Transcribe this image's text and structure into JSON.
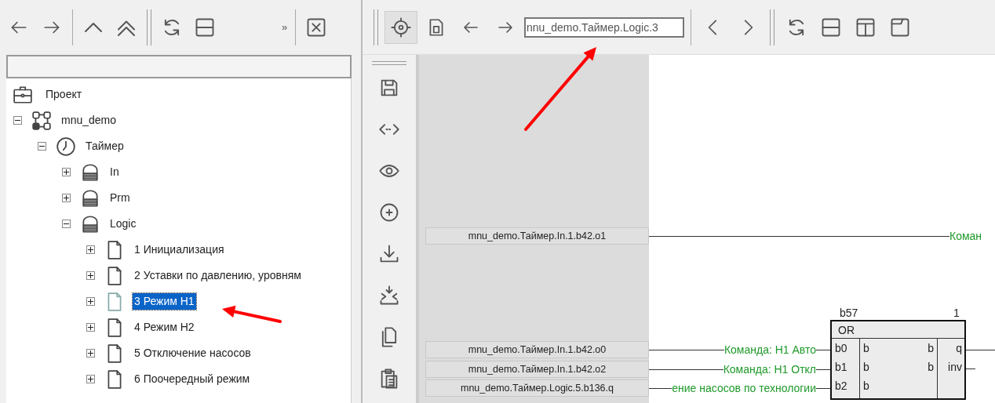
{
  "left_toolbar": {
    "overflow": "»"
  },
  "tree": [
    {
      "label": "Проект",
      "kind": "project",
      "selected": false,
      "children": [
        {
          "label": "mnu_demo",
          "kind": "network",
          "expanded": true,
          "selected": false,
          "children": [
            {
              "label": "Таймер",
              "kind": "clock",
              "expanded": true,
              "selected": false,
              "children": [
                {
                  "label": "In",
                  "kind": "stack",
                  "expanded": false,
                  "selected": false
                },
                {
                  "label": "Prm",
                  "kind": "stack",
                  "expanded": false,
                  "selected": false
                },
                {
                  "label": "Logic",
                  "kind": "stack",
                  "expanded": true,
                  "selected": false,
                  "children": [
                    {
                      "label": "1 Инициализация",
                      "kind": "page",
                      "expanded": false,
                      "selected": false
                    },
                    {
                      "label": "2 Уставки по давлению, уровням",
                      "kind": "page",
                      "expanded": false,
                      "selected": false
                    },
                    {
                      "label": "3 Режим Н1",
                      "kind": "page",
                      "expanded": false,
                      "selected": true
                    },
                    {
                      "label": "4 Режим Н2",
                      "kind": "page",
                      "expanded": false,
                      "selected": false
                    },
                    {
                      "label": "5 Отключение насосов",
                      "kind": "page",
                      "expanded": false,
                      "selected": false
                    },
                    {
                      "label": "6 Поочередный режим",
                      "kind": "page",
                      "expanded": false,
                      "selected": false
                    }
                  ]
                }
              ]
            }
          ]
        }
      ]
    }
  ],
  "editor_toolbar": {
    "path_field": "nnu_demo.Таймер.Logic.3"
  },
  "diagram": {
    "signals": [
      {
        "source": "mnu_demo.Таймер.In.1.b42.o1",
        "label": "Коман"
      },
      {
        "source": "mnu_demo.Таймер.In.1.b42.o0",
        "label": "Команда: Н1 Авто"
      },
      {
        "source": "mnu_demo.Таймер.In.1.b42.o2",
        "label": "Команда: Н1 Откл"
      },
      {
        "source": "mnu_demo.Таймер.Logic.5.b136.q",
        "label": "ение насосов по технологии"
      }
    ],
    "block": {
      "name": "b57",
      "number": "1",
      "type": "OR",
      "inputs": [
        "b0",
        "b1",
        "b2"
      ],
      "inner_left": [
        "b",
        "b",
        "b"
      ],
      "inner_right": [
        "b",
        "b"
      ],
      "outputs": [
        "q",
        "inv"
      ]
    }
  }
}
